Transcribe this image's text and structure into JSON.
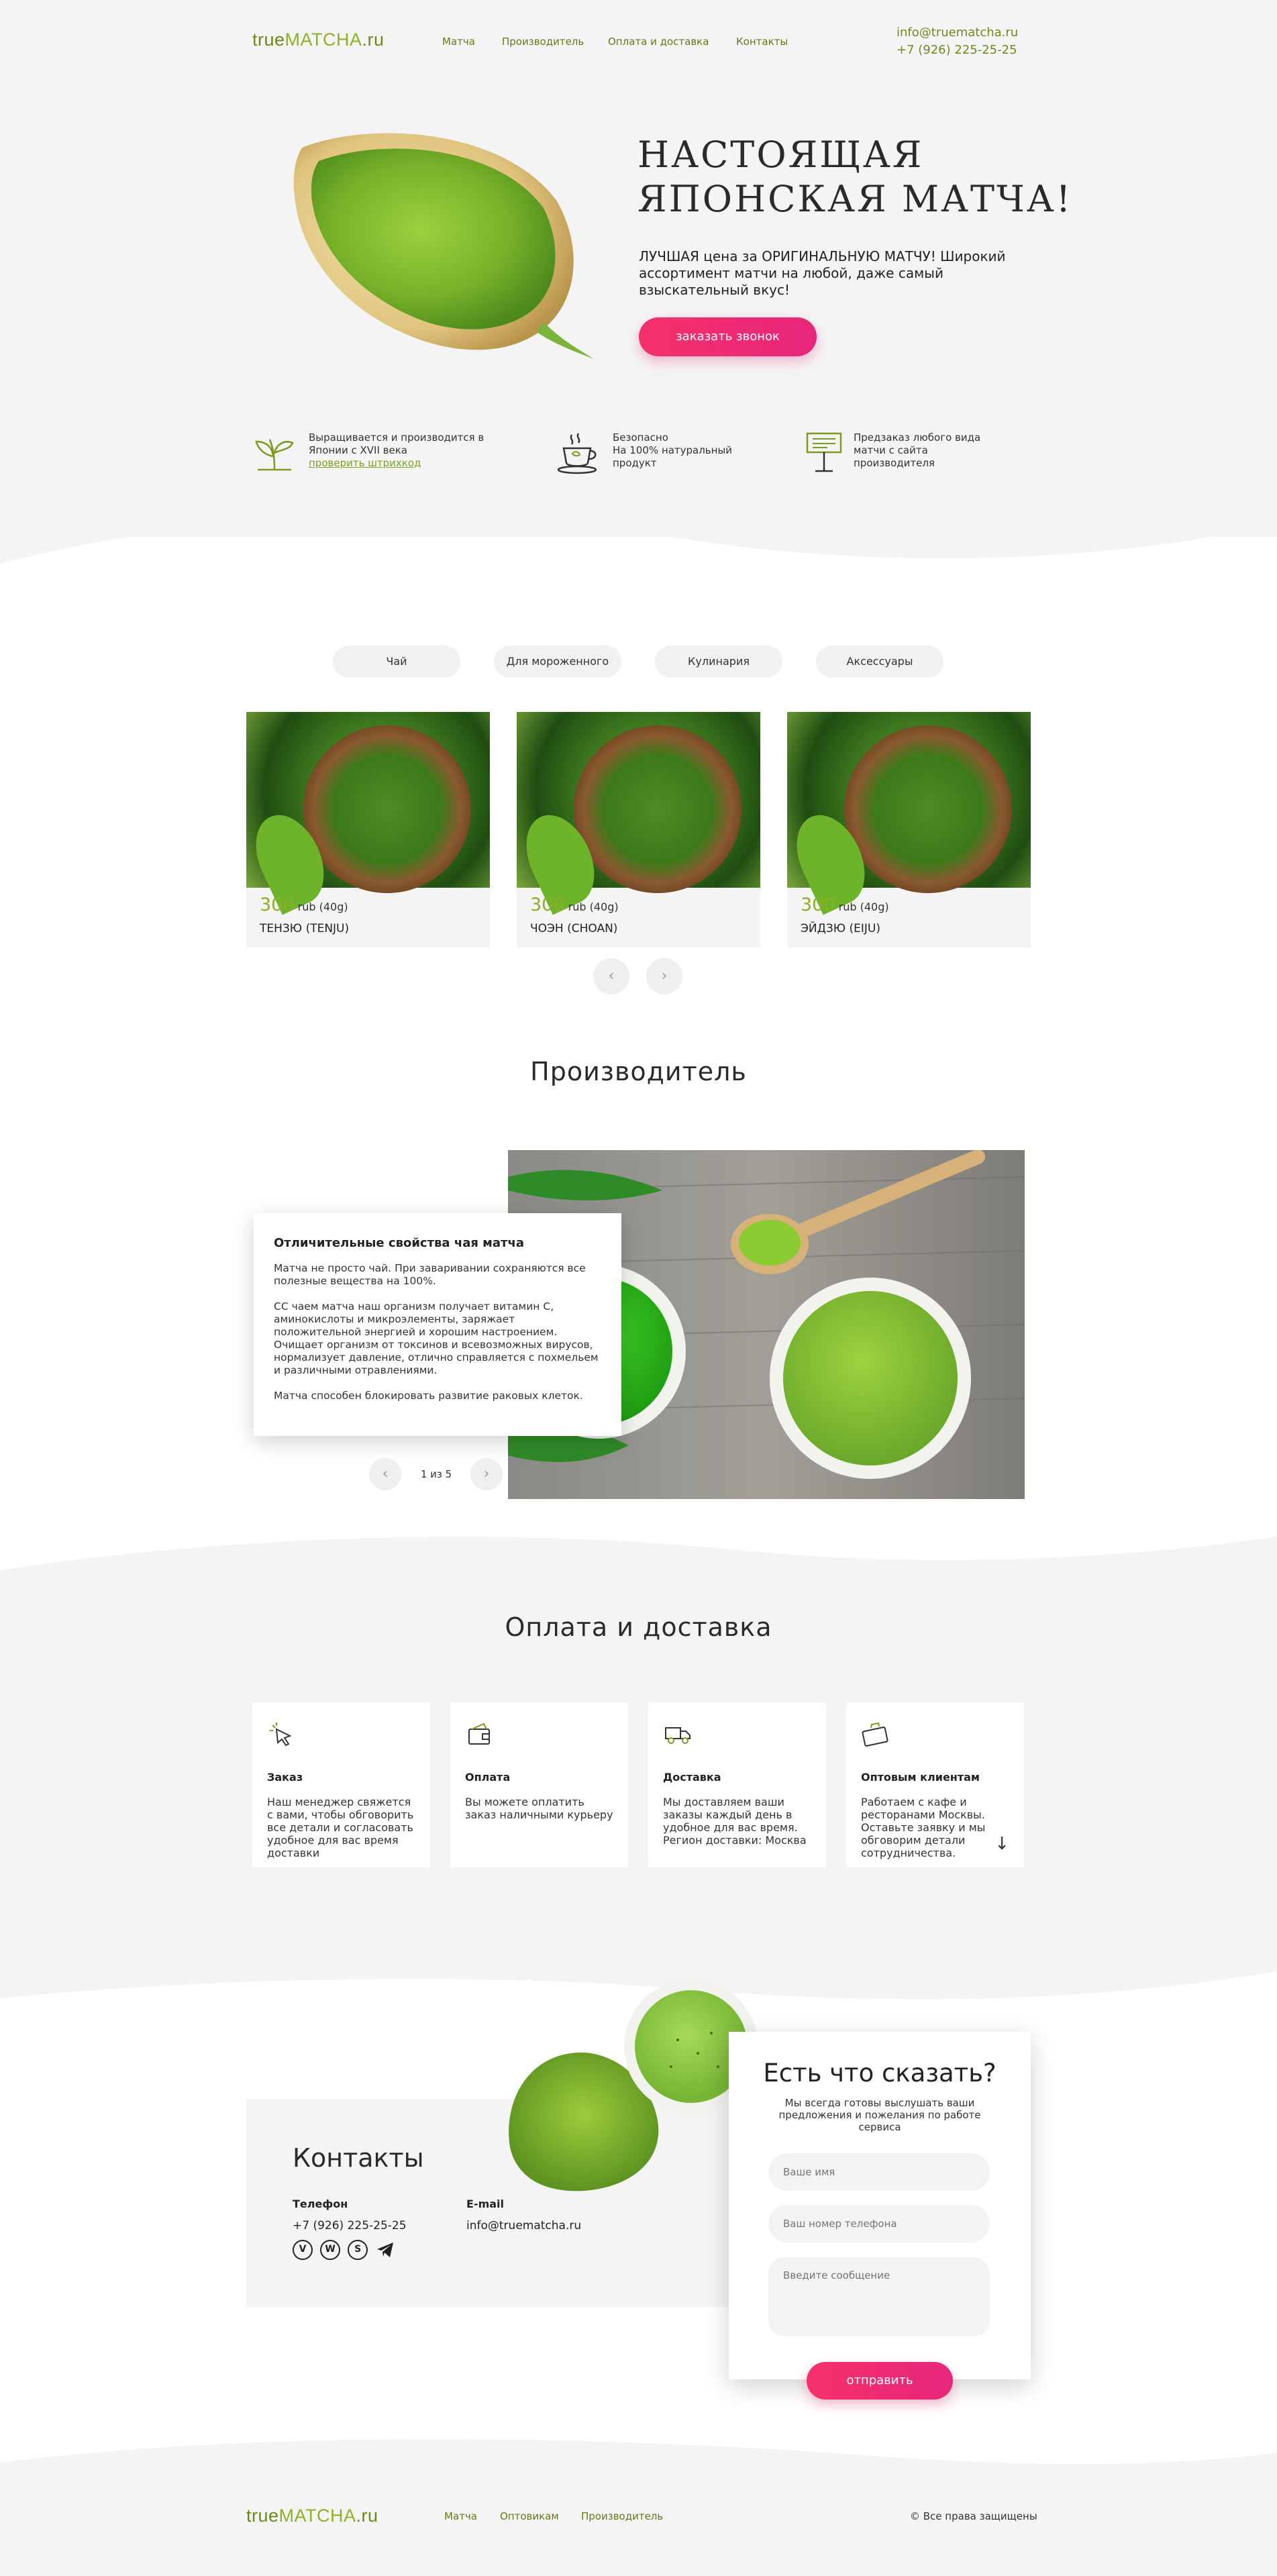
{
  "header": {
    "logo_prefix": "true",
    "logo_brand": "MATCHA",
    "logo_suffix": ".ru",
    "nav": [
      "Матча",
      "Производитель",
      "Оплата и доставка",
      "Контакты"
    ],
    "email": "info@truematcha.ru",
    "phone": "+7 (926) 225-25-25"
  },
  "hero": {
    "title_line1": "НАСТОЯЩАЯ",
    "title_line2": "ЯПОНСКАЯ МАТЧА!",
    "subtitle": "ЛУЧШАЯ цена за ОРИГИНАЛЬНУЮ МАТЧУ! Широкий ассортимент матчи на любой, даже самый взыскательный вкус!",
    "button": "заказать звонок"
  },
  "features": [
    {
      "icon": "sprout-icon",
      "line1": "Выращивается и производится в",
      "line2": "Японии с XVII века",
      "link": "проверить штрихкод"
    },
    {
      "icon": "tea-cup-icon",
      "line1": "Безопасно",
      "line2": "На 100% натуральный",
      "line3": "продукт"
    },
    {
      "icon": "sign-board-icon",
      "line1": "Предзаказ любого вида",
      "line2": "матчи с сайта",
      "line3": "производителя"
    }
  ],
  "catalog": {
    "tabs": [
      "Чай",
      "Для мороженного",
      "Кулинария",
      "Аксессуары"
    ],
    "products": [
      {
        "price": "300",
        "unit": "rub (40g)",
        "name": "ТЕНЗЮ (TENJU)"
      },
      {
        "price": "300",
        "unit": "rub (40g)",
        "name": "ЧОЭН (CHOAN)"
      },
      {
        "price": "300",
        "unit": "rub (40g)",
        "name": "ЭЙДЗЮ (EIJU)"
      }
    ],
    "prev": "‹",
    "next": "›"
  },
  "producer": {
    "heading": "Производитель",
    "card_title": "Отличительные свойства чая матча",
    "p1": "Матча не просто чай. При заваривании сохраняются все полезные вещества на 100%.",
    "p2": "СС чаем матча наш организм получает витамин С, аминокислоты и микроэлементы, заряжает положительной энергией и хорошим настроением. Очищает организм от токсинов и всевозможных вирусов, нормализует давление, отлично справляется с похмельем и различными отравлениями.",
    "p3": "Матча способен блокировать развитие раковых клеток.",
    "pager": "1 из 5",
    "prev": "‹",
    "next": "›"
  },
  "delivery": {
    "heading": "Оплата и доставка",
    "cards": [
      {
        "icon": "cursor-click-icon",
        "title": "Заказ",
        "text": "Наш менеджер свяжется с вами, чтобы обговорить все детали и согласовать удобное для вас время доставки"
      },
      {
        "icon": "wallet-icon",
        "title": "Оплата",
        "text": "Вы можете оплатить заказ наличными курьеру"
      },
      {
        "icon": "truck-icon",
        "title": "Доставка",
        "text": "Мы доставляем ваши заказы каждый день в удобное для вас время. Регион доставки: Москва"
      },
      {
        "icon": "briefcase-icon",
        "title": "Оптовым клиентам",
        "text": "Работаем с кафе и ресторанами Москвы. Оставьте заявку и мы обговорим детали сотрудничества."
      }
    ],
    "scroll_arrow": "↓"
  },
  "contacts": {
    "heading": "Контакты",
    "phone_label": "Телефон",
    "phone": "+7 (926) 225-25-25",
    "email_label": "E-mail",
    "email": "info@truematcha.ru",
    "messengers": [
      "viber-icon",
      "whatsapp-icon",
      "skype-icon",
      "telegram-icon"
    ],
    "form": {
      "title": "Есть что сказать?",
      "subtitle": "Мы всегда готовы выслушать ваши предложения и пожелания по работе сервиса",
      "name_placeholder": "Ваше имя",
      "phone_placeholder": "Ваш номер телефона",
      "message_placeholder": "Введите сообщение",
      "submit": "отправить"
    }
  },
  "footer": {
    "nav": [
      "Матча",
      "Оптовикам",
      "Производитель"
    ],
    "copyright": "© Все права защищены"
  },
  "colors": {
    "accent_green": "#8db226",
    "dark_green": "#6a8a17",
    "pink_button": "#f0306f",
    "grey_bg": "#f4f4f4"
  }
}
